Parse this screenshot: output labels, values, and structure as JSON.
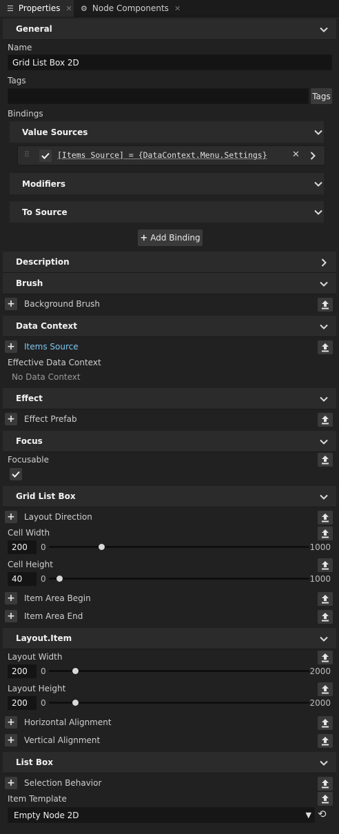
{
  "tabs": [
    {
      "label": "Properties",
      "icon": "list-icon",
      "active": true
    },
    {
      "label": "Node Components",
      "icon": "components-icon",
      "active": false
    }
  ],
  "general": {
    "title": "General",
    "name_label": "Name",
    "name_value": "Grid List Box 2D",
    "tags_label": "Tags",
    "tags_value": "",
    "tags_button": "Tags",
    "bindings_label": "Bindings",
    "value_sources_title": "Value Sources",
    "binding_expr": "[Items Source] = {DataContext.Menu.Settings}",
    "modifiers_title": "Modifiers",
    "to_source_title": "To Source",
    "add_binding": "Add Binding"
  },
  "description": {
    "title": "Description"
  },
  "brush": {
    "title": "Brush",
    "background_brush": "Background Brush"
  },
  "data_context": {
    "title": "Data Context",
    "items_source": "Items Source",
    "effective_label": "Effective Data Context",
    "effective_value": "No Data Context"
  },
  "effect": {
    "title": "Effect",
    "effect_prefab": "Effect Prefab"
  },
  "focus": {
    "title": "Focus",
    "focusable_label": "Focusable",
    "focusable_checked": true
  },
  "grid_list_box": {
    "title": "Grid List Box",
    "layout_direction": "Layout Direction",
    "cell_width_label": "Cell Width",
    "cell_width_value": "200",
    "cell_width_min": "0",
    "cell_width_max": "1000",
    "cell_width_fraction": 0.2,
    "cell_height_label": "Cell Height",
    "cell_height_value": "40",
    "cell_height_min": "0",
    "cell_height_max": "1000",
    "cell_height_fraction": 0.04,
    "item_area_begin": "Item Area Begin",
    "item_area_end": "Item Area End"
  },
  "layout_item": {
    "title": "Layout.Item",
    "layout_width_label": "Layout Width",
    "layout_width_value": "200",
    "layout_width_min": "0",
    "layout_width_max": "2000",
    "layout_width_fraction": 0.1,
    "layout_height_label": "Layout Height",
    "layout_height_value": "200",
    "layout_height_min": "0",
    "layout_height_max": "2000",
    "layout_height_fraction": 0.1,
    "horizontal_alignment": "Horizontal Alignment",
    "vertical_alignment": "Vertical Alignment"
  },
  "list_box": {
    "title": "List Box",
    "selection_behavior": "Selection Behavior",
    "item_template_label": "Item Template",
    "item_template_value": "Empty Node 2D"
  },
  "colors": {
    "link": "#7ec8f2",
    "background": "#212121",
    "header": "#2b2b2b"
  }
}
